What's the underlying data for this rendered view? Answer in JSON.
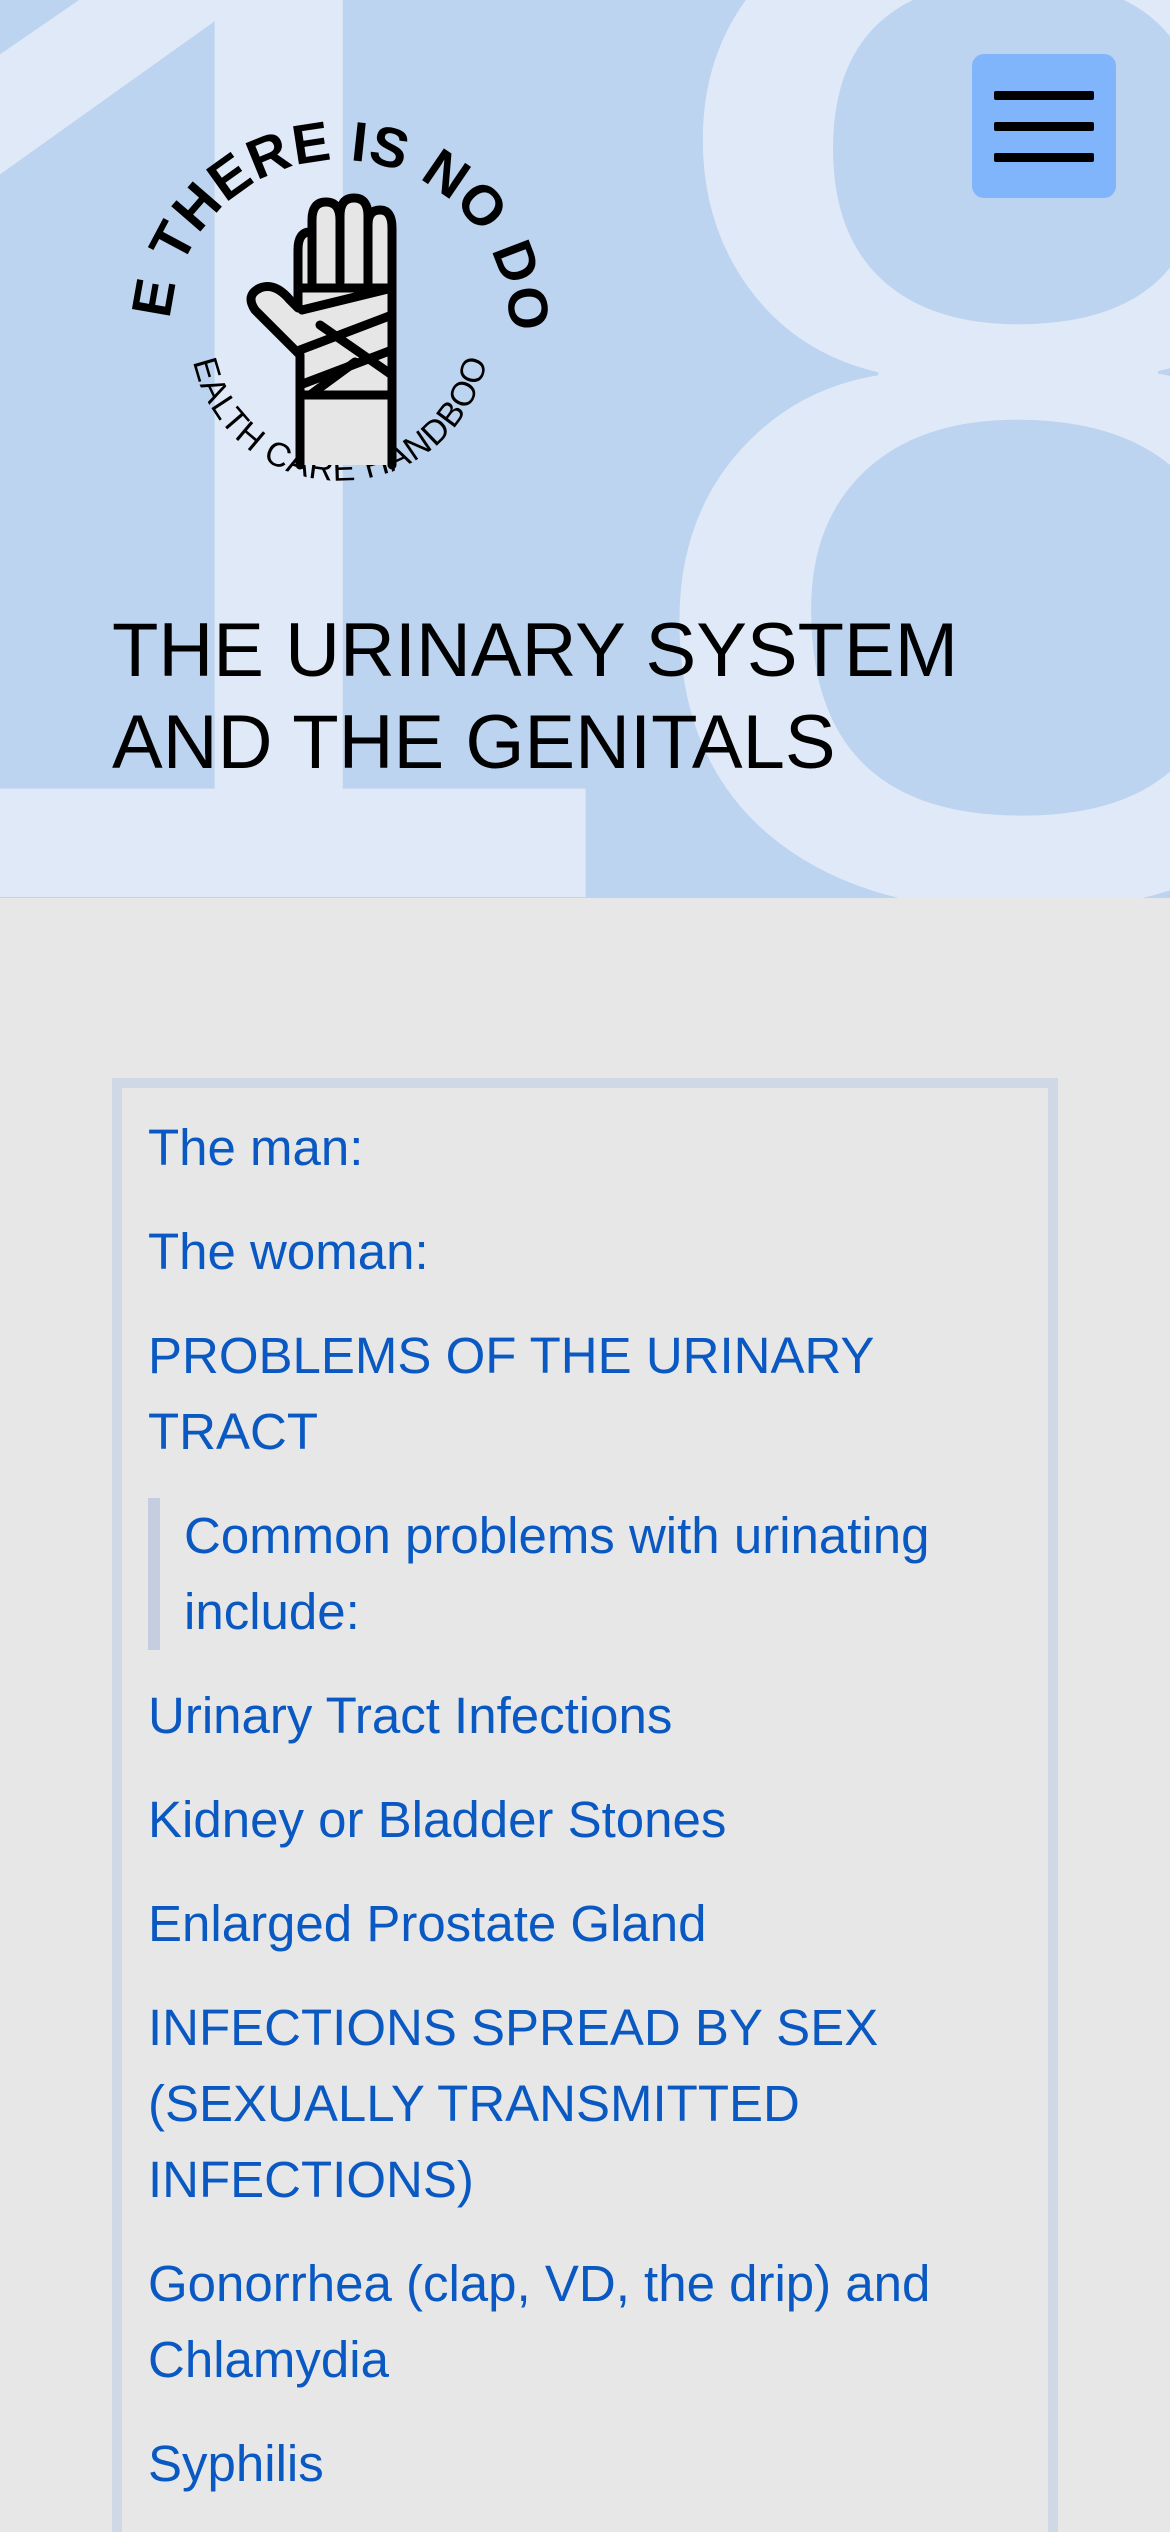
{
  "hero": {
    "chapter_number": "18",
    "logo": {
      "ring_text_top": "WHERE THERE IS NO DOCTOR",
      "ring_text_bottom": "HEALTH CARE HANDBOOK",
      "icon": "bandaged-hand-icon"
    },
    "title": "THE URINARY SYSTEM AND THE GENITALS",
    "menu_icon": "hamburger-menu-icon"
  },
  "colors": {
    "hero_bg": "#bcd4ef",
    "hero_number": "#e0e9f7",
    "menu_button": "#80b4fb",
    "page_bg": "#e7e7e8",
    "link": "#0a58c2",
    "toc_border": "#cfd9e5"
  },
  "toc": {
    "items": [
      {
        "label": "The man:"
      },
      {
        "label": "The woman:"
      },
      {
        "label": "PROBLEMS OF THE URINARY TRACT"
      },
      {
        "label": "Common problems with urinating include:"
      },
      {
        "label": "Urinary Tract Infections"
      },
      {
        "label": "Kidney or Bladder Stones"
      },
      {
        "label": "Enlarged Prostate Gland"
      },
      {
        "label": "INFECTIONS SPREAD BY SEX (SEXUALLY TRANSMITTED INFECTIONS)"
      },
      {
        "label": "Gonorrhea (clap, VD, the drip) and Chlamydia"
      },
      {
        "label": "Syphilis"
      }
    ]
  }
}
